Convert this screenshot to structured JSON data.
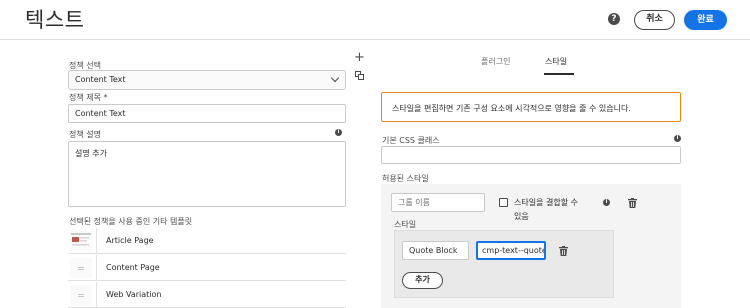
{
  "header": {
    "title": "텍스트",
    "cancel_label": "취소",
    "done_label": "완료"
  },
  "policy": {
    "select_label": "정책 선택",
    "selected_value": "Content Text",
    "title_label": "정책 제목 *",
    "title_value": "Content Text",
    "desc_label": "정책 설명",
    "desc_value": "설명 추가"
  },
  "templates": {
    "label": "선택된 정책을 사용 중인 기타 템플릿",
    "items": [
      {
        "name": "Article Page"
      },
      {
        "name": "Content Page"
      },
      {
        "name": "Web Variation"
      }
    ]
  },
  "tabs": [
    {
      "label": "플러그인"
    },
    {
      "label": "스타일"
    }
  ],
  "styles": {
    "alert_text": "스타일을 편집하면 기존 구성 요소에 시각적으로 영향을 줄 수 있습니다.",
    "css_class_label": "기본 CSS 클래스",
    "allowed_label": "허용된 스타일",
    "group_name_placeholder": "그룹 이름",
    "combine_label_line1": "스타일을 결합할 수",
    "combine_label_line2": "있음",
    "style_label": "스타일",
    "style_name": "Quote Block",
    "style_class": "cmp-text--quote",
    "add_label": "추가"
  },
  "colors": {
    "accent": "#1473e6",
    "alert_border": "#e68619"
  }
}
